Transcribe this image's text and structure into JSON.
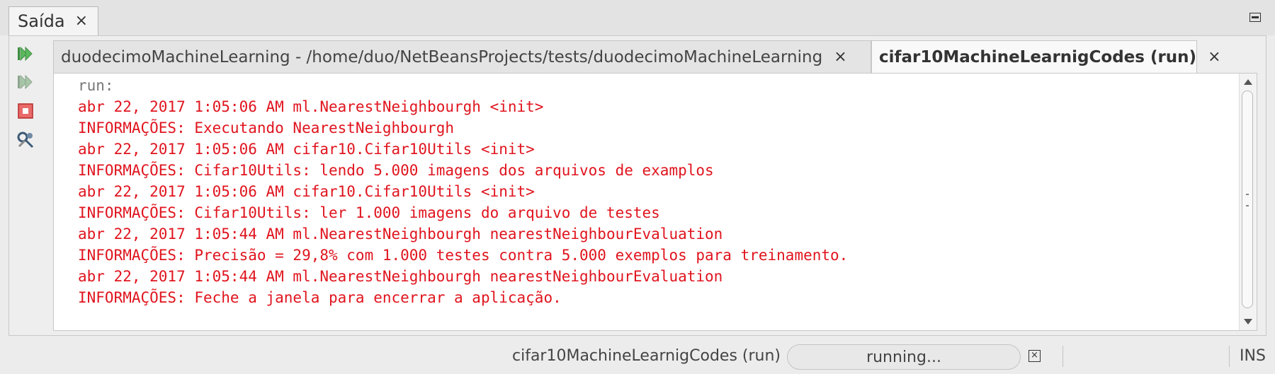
{
  "window": {
    "tab_label": "Saída",
    "close_glyph": "×"
  },
  "inner_tabs": [
    {
      "label": "duodecimoMachineLearning - /home/duo/NetBeansProjects/tests/duodecimoMachineLearning",
      "close_glyph": "×",
      "active": false
    },
    {
      "label": "cifar10MachineLearnigCodes (run)",
      "close_glyph": "×",
      "active": true
    }
  ],
  "toolbar": {
    "buttons": [
      {
        "icon": "rerun-icon"
      },
      {
        "icon": "rerun-with-params-icon"
      },
      {
        "icon": "stop-icon"
      },
      {
        "icon": "settings-tools-icon"
      }
    ]
  },
  "output": {
    "lines": [
      {
        "text": "run:",
        "color": "gray"
      },
      {
        "text": "abr 22, 2017 1:05:06 AM ml.NearestNeighbourgh <init>",
        "color": "red"
      },
      {
        "text": "INFORMAÇÕES: Executando NearestNeighbourgh",
        "color": "red"
      },
      {
        "text": "abr 22, 2017 1:05:06 AM cifar10.Cifar10Utils <init>",
        "color": "red"
      },
      {
        "text": "INFORMAÇÕES: Cifar10Utils: lendo 5.000 imagens dos arquivos de examplos",
        "color": "red"
      },
      {
        "text": "abr 22, 2017 1:05:06 AM cifar10.Cifar10Utils <init>",
        "color": "red"
      },
      {
        "text": "INFORMAÇÕES: Cifar10Utils: ler 1.000 imagens do arquivo de testes",
        "color": "red"
      },
      {
        "text": "abr 22, 2017 1:05:44 AM ml.NearestNeighbourgh nearestNeighbourEvaluation",
        "color": "red"
      },
      {
        "text": "INFORMAÇÕES: Precisão = 29,8% com 1.000 testes contra 5.000 exemplos para treinamento.",
        "color": "red"
      },
      {
        "text": "abr 22, 2017 1:05:44 AM ml.NearestNeighbourgh nearestNeighbourEvaluation",
        "color": "red"
      },
      {
        "text": "INFORMAÇÕES: Feche a janela para encerrar a aplicação.",
        "color": "red"
      }
    ]
  },
  "statusbar": {
    "task_name": "cifar10MachineLearnigCodes (run)",
    "progress_label": "running...",
    "mode": "INS"
  },
  "colors": {
    "error_text": "#e0141e",
    "plain_text": "#777777",
    "run_green": "#4caf50",
    "stop_red": "#e23b3b"
  }
}
